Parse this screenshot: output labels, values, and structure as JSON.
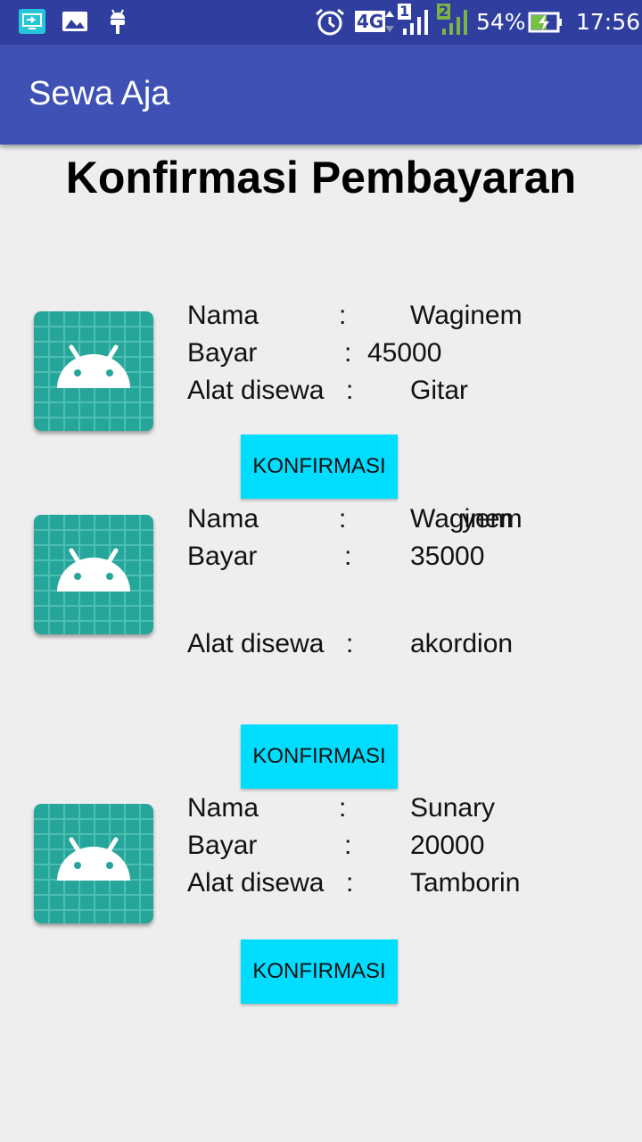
{
  "status_bar": {
    "time": "17:56",
    "battery_percent": "54%",
    "network_type": "4G",
    "sim1_label": "1",
    "sim2_label": "2",
    "icons": [
      "screen-mirror-icon",
      "gallery-icon",
      "android-debug-icon",
      "alarm-icon",
      "signal-icon",
      "battery-charging-icon"
    ]
  },
  "app_bar": {
    "title": "Sewa Aja"
  },
  "page": {
    "title": "Konfirmasi Pembayaran"
  },
  "items": [
    {
      "labels": {
        "nama": "Nama",
        "bayar": "Bayar",
        "alat": "Alat disewa",
        "colon": ":"
      },
      "nama": "Waginem",
      "bayar": "45000",
      "alat": "Gitar",
      "button": "KONFIRMASI"
    },
    {
      "labels": {
        "nama": "Nama",
        "bayar": "Bayar",
        "alat": "Alat disewa",
        "colon": ":"
      },
      "nama": "Waginem",
      "nama_overlap": "yem",
      "bayar": "35000",
      "alat": "akordion",
      "button": "KONFIRMASI"
    },
    {
      "labels": {
        "nama": "Nama",
        "bayar": "Bayar",
        "alat": "Alat disewa",
        "colon": ":"
      },
      "nama": "Sunary",
      "bayar": "20000",
      "alat": "Tamborin",
      "button": "KONFIRMASI"
    }
  ],
  "colors": {
    "status_bar": "#303f9f",
    "app_bar": "#3f51b5",
    "background": "#eeeeee",
    "button": "#00ddff",
    "thumbnail": "#26a69a"
  }
}
